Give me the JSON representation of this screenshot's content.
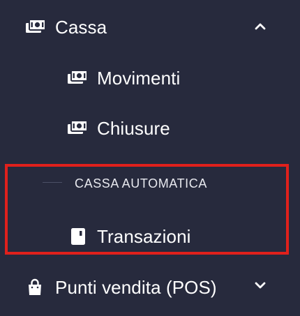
{
  "menu": {
    "cassa": {
      "label": "Cassa",
      "icon": "money-bill-icon",
      "expanded": true
    },
    "movimenti": {
      "label": "Movimenti",
      "icon": "money-bill-icon"
    },
    "chiusure": {
      "label": "Chiusure",
      "icon": "money-bill-icon"
    },
    "section_cassa_automatica": {
      "label": "CASSA AUTOMATICA"
    },
    "transazioni": {
      "label": "Transazioni",
      "icon": "receipt-icon"
    },
    "punti_vendita": {
      "label": "Punti vendita (POS)",
      "icon": "shopping-bag-icon",
      "expanded": false
    }
  },
  "colors": {
    "background": "#272a3d",
    "text": "#ffffff",
    "highlight": "#e0201c"
  }
}
